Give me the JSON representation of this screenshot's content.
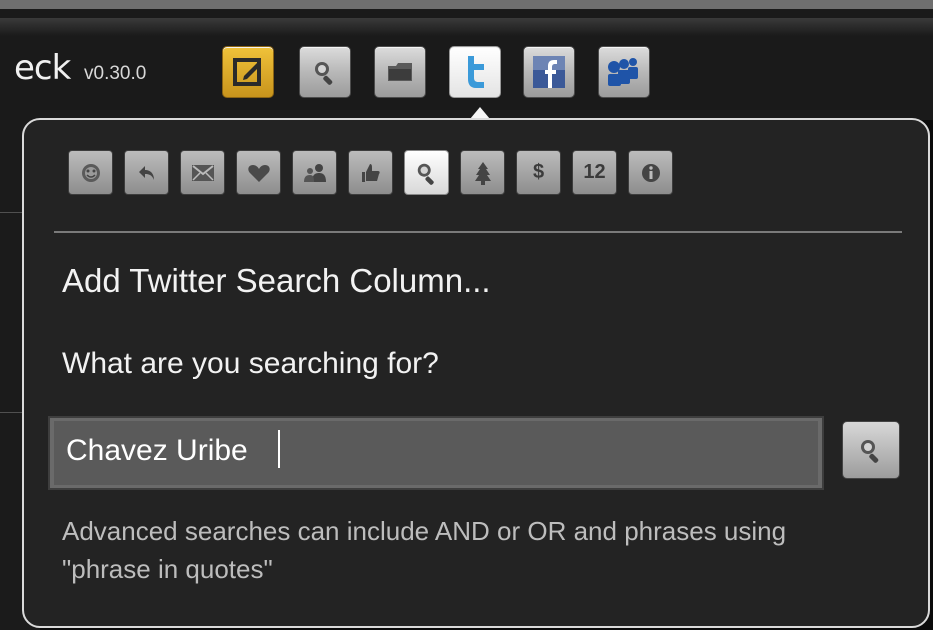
{
  "app": {
    "title": "eck",
    "version": "v0.30.0"
  },
  "toolbar": {
    "buttons": [
      {
        "icon": "compose-icon",
        "state": "normal"
      },
      {
        "icon": "search-icon",
        "state": "normal"
      },
      {
        "icon": "folder-icon",
        "state": "normal"
      },
      {
        "icon": "twitter-icon",
        "state": "active"
      },
      {
        "icon": "facebook-icon",
        "state": "normal"
      },
      {
        "icon": "myspace-icon",
        "state": "normal"
      }
    ]
  },
  "popover": {
    "column_types": [
      {
        "icon": "smiley-icon"
      },
      {
        "icon": "reply-icon"
      },
      {
        "icon": "mail-icon"
      },
      {
        "icon": "favorite-heart-icon"
      },
      {
        "icon": "group-icon"
      },
      {
        "icon": "thumbs-up-icon"
      },
      {
        "icon": "search-icon",
        "selected": true
      },
      {
        "icon": "tree-icon"
      },
      {
        "label": "$",
        "icon": "dollar-icon"
      },
      {
        "label": "12",
        "icon": "twelve-badge-icon"
      },
      {
        "icon": "info-icon"
      }
    ],
    "title": "Add Twitter Search Column...",
    "search_label": "What are you searching for?",
    "search_value": "Chavez Uribe",
    "hint": "Advanced searches can include AND or OR and phrases using \"phrase in quotes\""
  },
  "colors": {
    "background": "#0b0b0b",
    "panel": "#232323",
    "panel_border": "#dadada",
    "text": "#f2f2f2",
    "hint": "#bdbdbd",
    "compose_accent": "#f0c23a",
    "twitter_blue": "#3b9ad9",
    "facebook_blue": "#3b5998",
    "myspace_blue": "#1f54a8"
  }
}
